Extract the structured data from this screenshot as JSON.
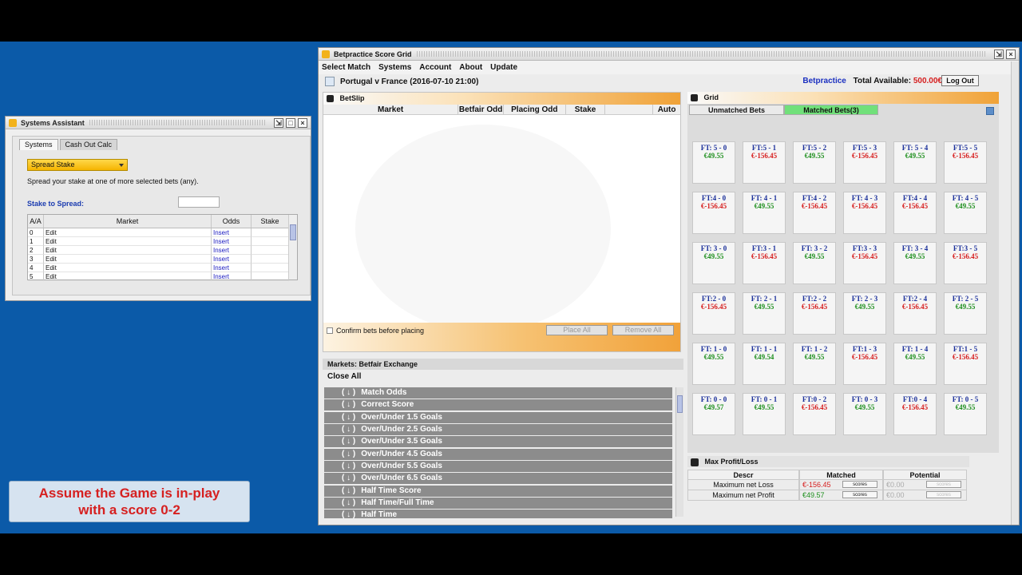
{
  "systems_assistant": {
    "title": "Systems Assistant",
    "tabs": [
      "Systems",
      "Cash Out Calc"
    ],
    "strategy": "Spread Stake",
    "description": "Spread your stake at one of more selected bets (any).",
    "stake_label": "Stake to Spread:",
    "columns": [
      "A/A",
      "Market",
      "Odds",
      "Stake"
    ],
    "rows": [
      {
        "n": "0",
        "market": "Edit",
        "odds": "Insert"
      },
      {
        "n": "1",
        "market": "Edit",
        "odds": "Insert"
      },
      {
        "n": "2",
        "market": "Edit",
        "odds": "Insert"
      },
      {
        "n": "3",
        "market": "Edit",
        "odds": "Insert"
      },
      {
        "n": "4",
        "market": "Edit",
        "odds": "Insert"
      },
      {
        "n": "5",
        "market": "Edit",
        "odds": "Insert"
      }
    ]
  },
  "banner": {
    "line1": "Assume the Game is in-play",
    "line2": "with a score 0-2"
  },
  "main": {
    "title": "Betpractice Score Grid",
    "menu": [
      "Select Match",
      "Systems",
      "Account",
      "About",
      "Update"
    ],
    "match": "Portugal v France (2016-07-10 21:00)",
    "account_name": "Betpractice",
    "total_label": "Total Available:",
    "total_value": "500.00€",
    "logout": "Log Out"
  },
  "betslip": {
    "title": "BetSlip",
    "columns": [
      "Market",
      "Betfair Odd",
      "Placing Odd",
      "Stake",
      "",
      "Auto"
    ],
    "confirm": "Confirm bets before placing",
    "place_all": "Place All",
    "remove_all": "Remove All"
  },
  "markets": {
    "title": "Markets: Betfair Exchange",
    "close_all": "Close All",
    "arrow": "( ↓ )",
    "items": [
      "Match Odds",
      "Correct Score",
      "Over/Under 1.5 Goals",
      "Over/Under 2.5 Goals",
      "Over/Under 3.5 Goals",
      "Over/Under 4.5 Goals",
      "Over/Under 5.5 Goals",
      "Over/Under 6.5 Goals",
      "Half Time Score",
      "Half Time/Full Time",
      "Half Time"
    ]
  },
  "grid": {
    "title": "Grid",
    "tab_unmatched": "Unmatched Bets",
    "tab_matched": "Matched Bets(3)",
    "rows": [
      [
        [
          "FT: 5 - 0",
          "€49.55",
          "p"
        ],
        [
          "FT:5 - 1",
          "€-156.45",
          "n"
        ],
        [
          "FT:5 - 2",
          "€49.55",
          "p"
        ],
        [
          "FT:5 - 3",
          "€-156.45",
          "n"
        ],
        [
          "FT: 5 - 4",
          "€49.55",
          "p"
        ],
        [
          "FT:5 - 5",
          "€-156.45",
          "n"
        ]
      ],
      [
        [
          "FT:4 - 0",
          "€-156.45",
          "n"
        ],
        [
          "FT: 4 - 1",
          "€49.55",
          "p"
        ],
        [
          "FT:4 - 2",
          "€-156.45",
          "n"
        ],
        [
          "FT: 4 - 3",
          "€-156.45",
          "n"
        ],
        [
          "FT:4 - 4",
          "€-156.45",
          "n"
        ],
        [
          "FT: 4 - 5",
          "€49.55",
          "p"
        ]
      ],
      [
        [
          "FT: 3 - 0",
          "€49.55",
          "p"
        ],
        [
          "FT:3 - 1",
          "€-156.45",
          "n"
        ],
        [
          "FT: 3 - 2",
          "€49.55",
          "p"
        ],
        [
          "FT:3 - 3",
          "€-156.45",
          "n"
        ],
        [
          "FT: 3 - 4",
          "€49.55",
          "p"
        ],
        [
          "FT:3 - 5",
          "€-156.45",
          "n"
        ]
      ],
      [
        [
          "FT:2 - 0",
          "€-156.45",
          "n"
        ],
        [
          "FT: 2 - 1",
          "€49.55",
          "p"
        ],
        [
          "FT:2 - 2",
          "€-156.45",
          "n"
        ],
        [
          "FT: 2 - 3",
          "€49.55",
          "p"
        ],
        [
          "FT:2 - 4",
          "€-156.45",
          "n"
        ],
        [
          "FT: 2 - 5",
          "€49.55",
          "p"
        ]
      ],
      [
        [
          "FT: 1 - 0",
          "€49.55",
          "p"
        ],
        [
          "FT: 1 - 1",
          "€49.54",
          "p"
        ],
        [
          "FT: 1 - 2",
          "€49.55",
          "p"
        ],
        [
          "FT:1 - 3",
          "€-156.45",
          "n"
        ],
        [
          "FT: 1 - 4",
          "€49.55",
          "p"
        ],
        [
          "FT:1 - 5",
          "€-156.45",
          "n"
        ]
      ],
      [
        [
          "FT: 0 - 0",
          "€49.57",
          "p"
        ],
        [
          "FT: 0 - 1",
          "€49.55",
          "p"
        ],
        [
          "FT:0 - 2",
          "€-156.45",
          "n"
        ],
        [
          "FT: 0 - 3",
          "€49.55",
          "p"
        ],
        [
          "FT:0 - 4",
          "€-156.45",
          "n"
        ],
        [
          "FT: 0 - 5",
          "€49.55",
          "p"
        ]
      ]
    ]
  },
  "max_pl": {
    "title": "Max Profit/Loss",
    "col_descr": "Descr",
    "col_matched": "Matched",
    "col_potential": "Potential",
    "loss_label": "Maximum net Loss",
    "loss_matched": "€-156.45",
    "profit_label": "Maximum net Profit",
    "profit_matched": "€49.57",
    "potential_value": "€0.00",
    "scores_btn": "scores"
  },
  "colors": {
    "desktop": "#0b5aa8",
    "positive": "#1e8f1e",
    "negative": "#d61c1c",
    "matched_tab": "#71e07a"
  }
}
